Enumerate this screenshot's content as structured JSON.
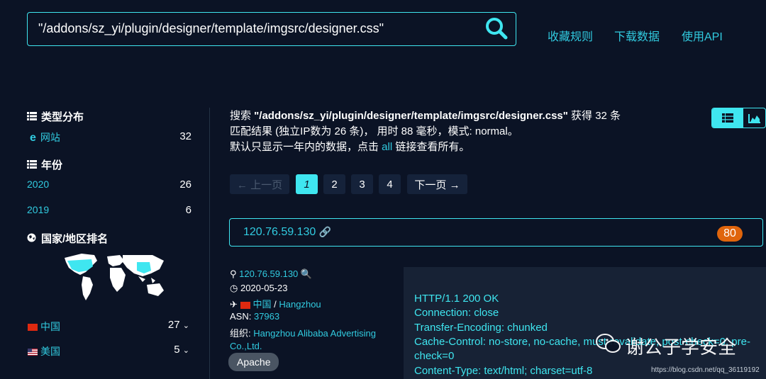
{
  "search": {
    "query": "\"/addons/sz_yi/plugin/designer/template/imgsrc/designer.css\""
  },
  "toplinks": [
    "收藏规则",
    "下载数据",
    "使用API"
  ],
  "sidebar": {
    "type_title": "类型分布",
    "type_items": [
      {
        "label": "网站",
        "count": "32"
      }
    ],
    "year_title": "年份",
    "year_items": [
      {
        "label": "2020",
        "count": "26"
      },
      {
        "label": "2019",
        "count": "6"
      }
    ],
    "country_title": "国家/地区排名",
    "country_items": [
      {
        "label": "中国",
        "count": "27"
      },
      {
        "label": "美国",
        "count": "5"
      }
    ]
  },
  "summary": {
    "prefix": "搜索 ",
    "query": "\"/addons/sz_yi/plugin/designer/template/imgsrc/designer.css\"",
    "mid": " 获得 32 条",
    "line2": "匹配结果 (独立IP数为 26 条)， 用时 88 毫秒，模式: normal。",
    "line3_a": "默认只显示一年内的数据，点击 ",
    "line3_link": "all",
    "line3_b": " 链接查看所有。"
  },
  "pagination": {
    "prev": "← 上一页",
    "pages": [
      "1",
      "2",
      "3",
      "4"
    ],
    "next": "下一页 →"
  },
  "result": {
    "ip": "120.76.59.130",
    "port": "80",
    "ip_link": "120.76.59.130",
    "date": "2020-05-23",
    "country": "中国",
    "city": "Hangzhou",
    "asn_label": "ASN:",
    "asn": "37963",
    "org_label": "组织:",
    "org_line1": "Hangzhou Alibaba Advertising",
    "org_line2": "Co.,Ltd.",
    "tag": "Apache",
    "banner": [
      "HTTP/1.1 200 OK",
      "Connection: close",
      "Transfer-Encoding: chunked",
      "Cache-Control: no-store, no-cache, must-revalidate, post-check=0, pre-",
      "check=0",
      "Content-Type: text/html; charset=utf-8"
    ]
  },
  "watermark": {
    "text": "谢公子学安全",
    "url": "https://blog.csdn.net/qq_36119192"
  },
  "colors": {
    "accent": "#3fe6f0",
    "link": "#31cbe0",
    "background": "#0b1325",
    "port_badge": "#e0650c"
  }
}
